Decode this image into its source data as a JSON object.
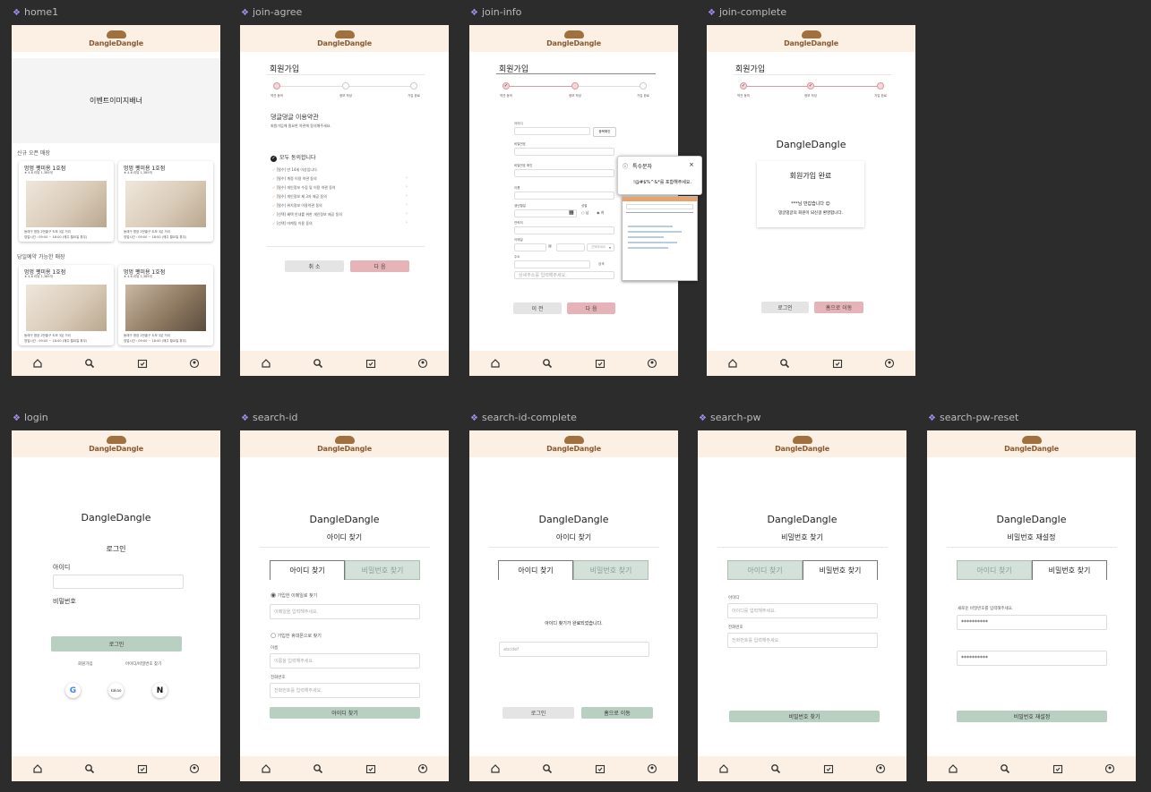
{
  "brand": {
    "logo": "DangleDangle",
    "name": "DangleDangle"
  },
  "nav": {
    "icons": [
      "home-icon",
      "search-icon",
      "calendar-check-icon",
      "user-circle-icon"
    ]
  },
  "frames": {
    "home1": {
      "label": "home1",
      "banner": "이벤트이미지배너",
      "section1": "신규 오픈 매장",
      "section2": "당일예약 가능한 매장",
      "cards": [
        {
          "name": "멍멍 펫미용 1호점",
          "rating": "★ 4.6 리뷰 1,389개",
          "addr": "동래구 명장 2번출구 도보 3분 거리",
          "hours": "영업시간 : 09:00 ~ 18:00 (매주 월요일 휴무)"
        },
        {
          "name": "멍멍 펫미용 1호점",
          "rating": "★ 4.6 리뷰 1,389개",
          "addr": "동래구 명장 2번출구 도보 3분 거리",
          "hours": "영업시간 : 09:00 ~ 18:00 (매주 월요일 휴무)"
        },
        {
          "name": "멍멍 펫미용 1호점",
          "rating": "★ 4.6 리뷰 1,389개",
          "addr": "동래구 명장 2번출구 도보 3분 거리",
          "hours": "영업시간 : 09:00 ~ 18:00 (매주 월요일 휴무)"
        },
        {
          "name": "멍멍 펫미용 1호점",
          "rating": "★ 4.6 리뷰 1,389개",
          "addr": "동래구 명장 2번출구 도보 3분 거리",
          "hours": "영업시간 : 09:00 ~ 18:00 (매주 월요일 휴무)"
        }
      ]
    },
    "join_agree": {
      "label": "join-agree",
      "title": "회원가입",
      "steps": [
        "약관 동의",
        "정보 작성",
        "가입 완료"
      ],
      "terms_title": "댕글댕글 이용약관",
      "terms_desc": "회원가입에 필요한 약관에 동의해주세요.",
      "all": "모두 동의합니다",
      "items": [
        "[필수] 만 14세 이상입니다.",
        "[필수] 계정 이용 약관 동의",
        "[필수] 개인정보 수집 및 이용 약관 동의",
        "[필수] 개인정보 제 3자 제공 동의",
        "[필수] 위치정보 이용약관 동의",
        "[선택] 혜택 안내를 위한 개인정보 제공 동의",
        "[선택] 마케팅 이용 동의"
      ],
      "cancel": "취 소",
      "next": "다 음"
    },
    "join_info": {
      "label": "join-info",
      "title": "회원가입",
      "steps": [
        "약관 동의",
        "정보 작성",
        "가입 완료"
      ],
      "fields": [
        "아이디",
        "비밀번호",
        "비밀번호 확인",
        "이름",
        "생년월일",
        "연락처",
        "이메일",
        "주소"
      ],
      "dup_btn": "중복확인",
      "gender": "성별",
      "male": "남",
      "female": "여",
      "search": "검색",
      "domain": "선택하세요",
      "address_ph": "상세주소를 입력해주세요.",
      "popup_title": "특수문자",
      "popup_msg": "!@#$%^&*를 포함해주세요.",
      "prev": "이 전",
      "next": "다 음"
    },
    "join_complete": {
      "label": "join-complete",
      "title": "회원가입",
      "steps": [
        "약관 동의",
        "정보 작성",
        "가입 완료"
      ],
      "brand": "DangleDangle",
      "done": "회원가입 완료",
      "welcome": "***님 반갑습니다 😊",
      "msg": "댕글댕글의 회원이 되신걸 환영합니다.",
      "login": "로그인",
      "home": "홈으로 이동"
    },
    "login": {
      "label": "login",
      "brand": "DangleDangle",
      "title": "로그인",
      "id": "아이디",
      "pw": "비밀번호",
      "btn": "로그인",
      "join": "회원가입",
      "find": "아이디/비밀번호 찾기",
      "social": [
        "G",
        "kakao",
        "N"
      ]
    },
    "search_id": {
      "label": "search-id",
      "brand": "DangleDangle",
      "title": "아이디 찾기",
      "tab1": "아이디 찾기",
      "tab2": "비밀번호 찾기",
      "opt1": "가입한 이메일로 찾기",
      "email_ph": "이메일을 입력해주세요.",
      "opt2": "가입한 휴대폰으로 찾기",
      "name": "이름",
      "name_ph": "이름을 입력해주세요.",
      "phone": "전화번호",
      "phone_ph": "전화번호를 입력해주세요.",
      "btn": "아이디 찾기"
    },
    "search_id_complete": {
      "label": "search-id-complete",
      "brand": "DangleDangle",
      "title": "아이디 찾기",
      "tab1": "아이디 찾기",
      "tab2": "비밀번호 찾기",
      "msg": "아이디 찾기가 완료되었습니다.",
      "result": "abcdef",
      "login": "로그인",
      "home": "홈으로 이동"
    },
    "search_pw": {
      "label": "search-pw",
      "brand": "DangleDangle",
      "title": "비밀번호 찾기",
      "tab1": "아이디 찾기",
      "tab2": "비밀번호 찾기",
      "id": "아이디",
      "id_ph": "아이디를 입력해주세요.",
      "phone": "전화번호",
      "phone_ph": "전화번호를 입력해주세요.",
      "btn": "비밀번호 찾기"
    },
    "search_pw_reset": {
      "label": "search-pw-reset",
      "brand": "DangleDangle",
      "title": "비밀번호 재설정",
      "tab1": "아이디 찾기",
      "tab2": "비밀번호 찾기",
      "desc": "새로운 비밀번호를 입력해주세요.",
      "pw1": "**********",
      "pw2": "**********",
      "btn": "비밀번호 재설정"
    }
  }
}
